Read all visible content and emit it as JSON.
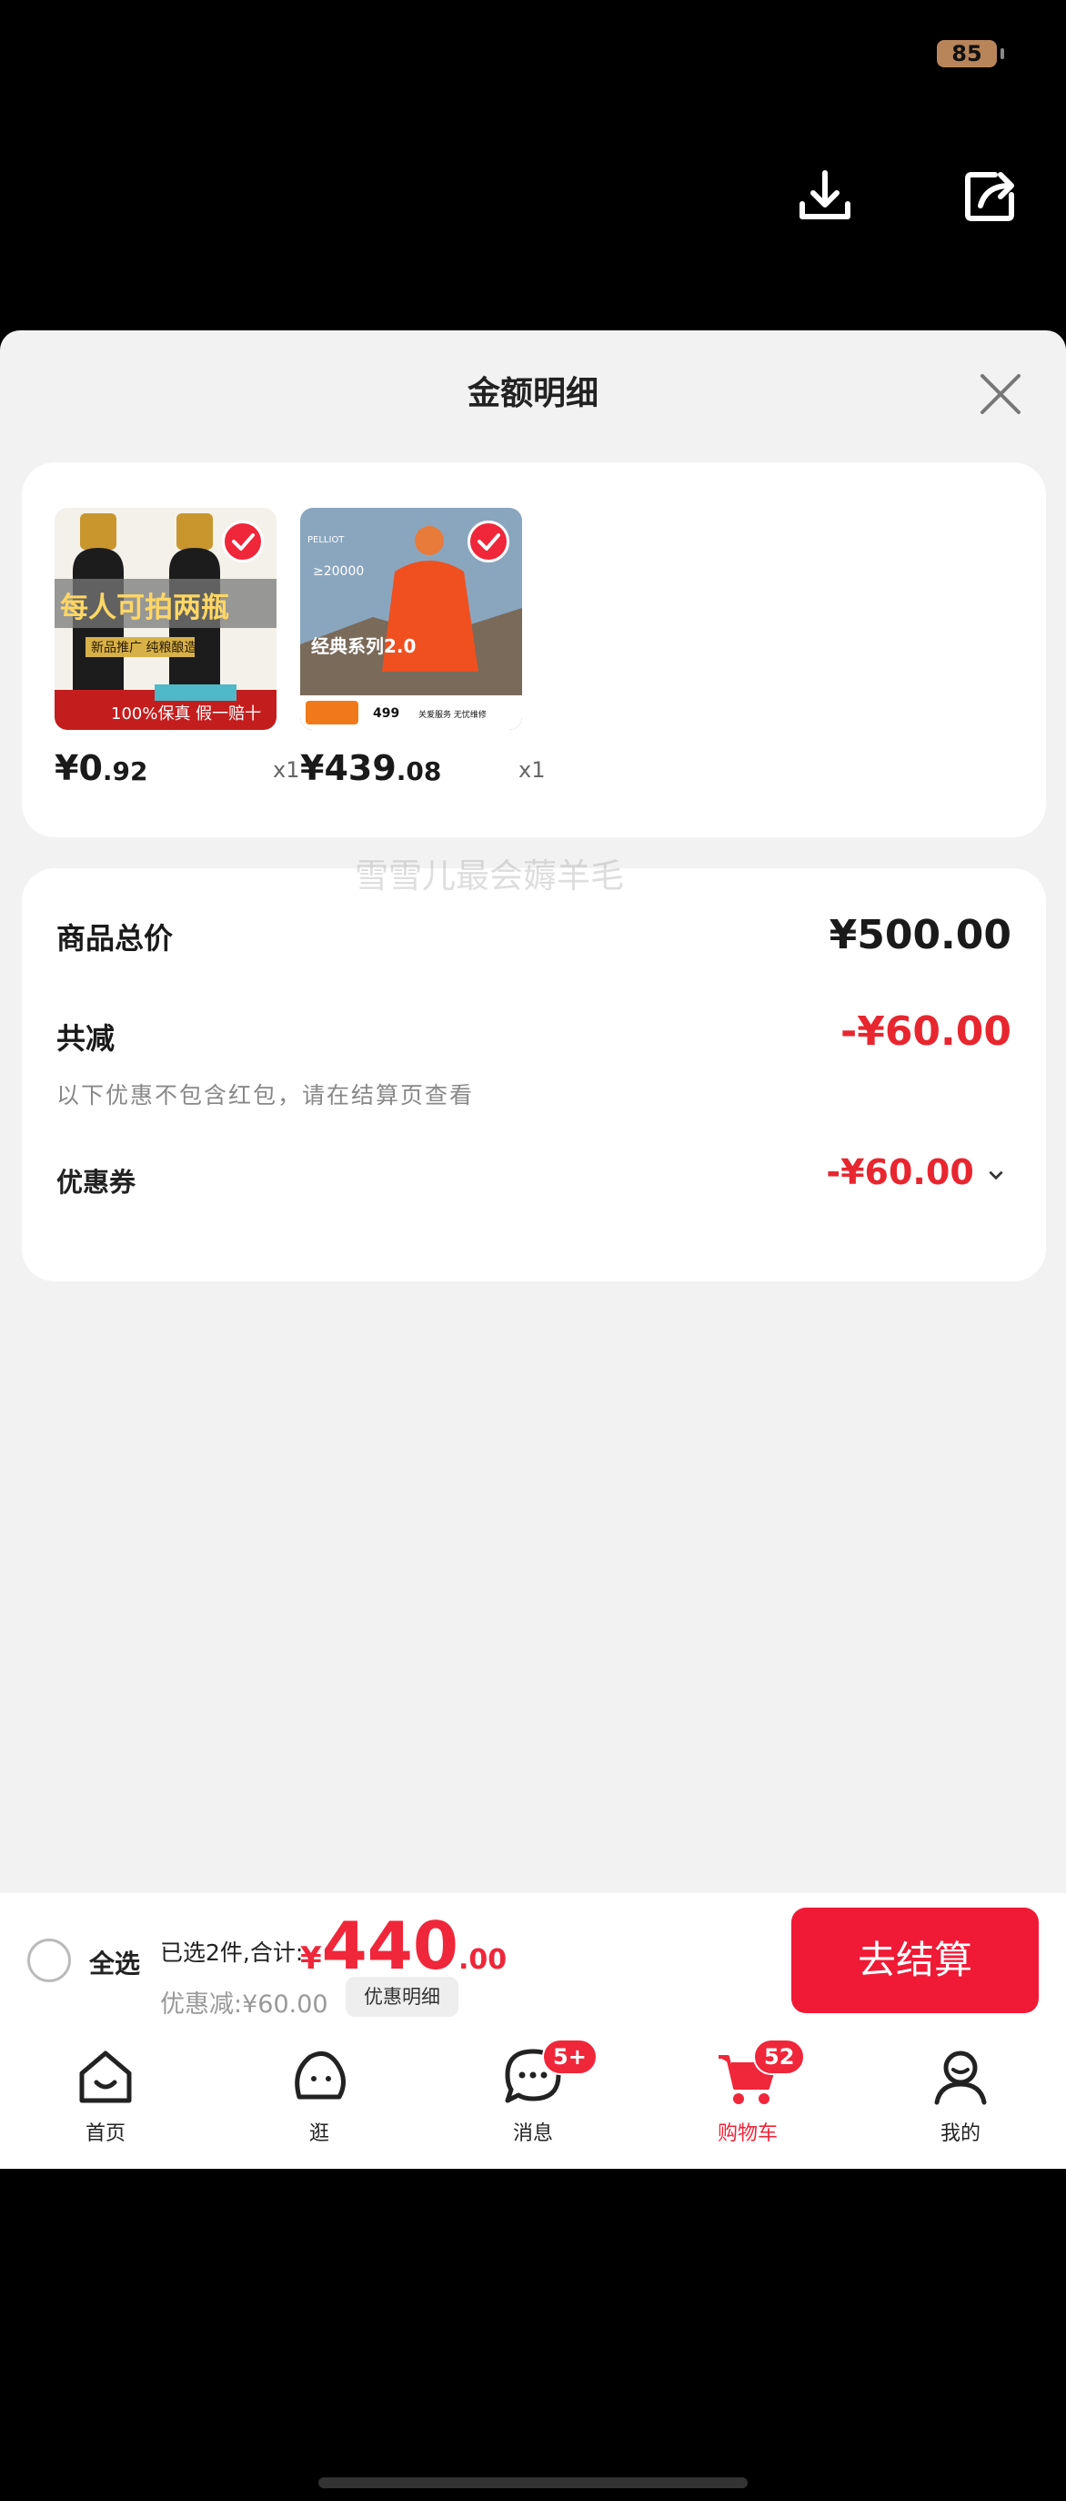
{
  "status_bar": {
    "battery": "85"
  },
  "top_actions": {
    "download": "download-icon",
    "share": "share-icon"
  },
  "sheet": {
    "title": "金额明细"
  },
  "products": [
    {
      "price_main": "¥0",
      "price_decimal": ".92",
      "qty": "x1",
      "image_text": [
        "每人可拍两瓶",
        "新品推广 纯粮酿造",
        "100%保真 假一赔十"
      ]
    },
    {
      "price_main": "¥439",
      "price_decimal": ".08",
      "qty": "x1",
      "image_text": [
        "PELLIOT",
        "≥20000",
        "经典系列2.0",
        "499",
        "关爱服务 无忧维修"
      ]
    }
  ],
  "detail": {
    "total_label": "商品总价",
    "total_value": "¥500.00",
    "reduce_label": "共减",
    "reduce_value": "-¥60.00",
    "note": "以下优惠不包含红包，请在结算页查看",
    "coupon_label": "优惠券",
    "coupon_value": "-¥60.00"
  },
  "watermark": "雪雪儿最会薅羊毛",
  "checkout": {
    "select_all": "全选",
    "selected_text": "已选2件,合计:",
    "total_currency": "¥",
    "total_main": "440",
    "total_cents": ".00",
    "discount_text": "优惠减:¥60.00",
    "detail_chip": "优惠明细",
    "checkout_button": "去结算"
  },
  "tabbar": {
    "items": [
      {
        "label": "首页",
        "icon": "home-icon"
      },
      {
        "label": "逛",
        "icon": "browse-icon"
      },
      {
        "label": "消息",
        "icon": "message-icon",
        "badge": "5+"
      },
      {
        "label": "购物车",
        "icon": "cart-icon",
        "badge": "52"
      },
      {
        "label": "我的",
        "icon": "profile-icon"
      }
    ]
  },
  "colors": {
    "accent": "#f0263a",
    "reduce": "#e8262f"
  }
}
